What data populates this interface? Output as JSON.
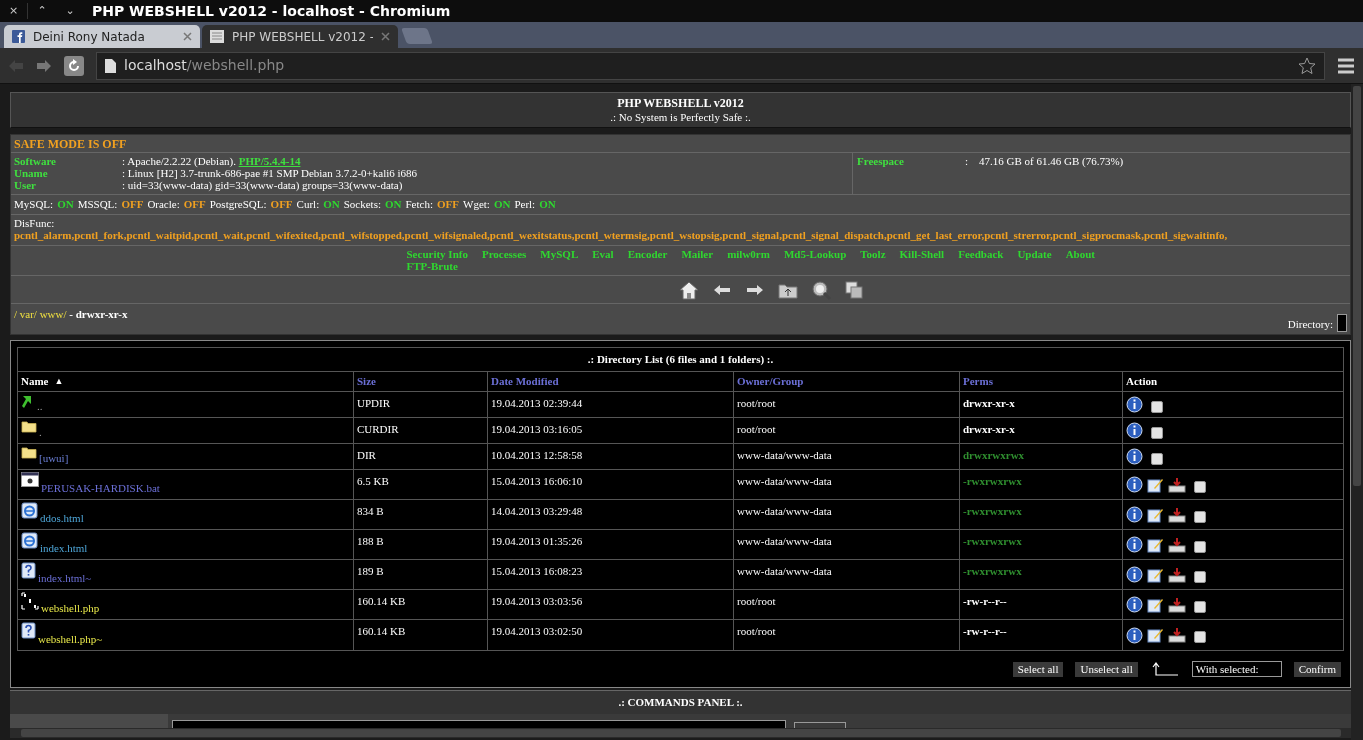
{
  "window": {
    "title": "PHP WEBSHELL v2012 - localhost - Chromium",
    "controls": [
      "×",
      "⌃",
      "⌄"
    ]
  },
  "tabs": [
    {
      "label": "Deini Rony Natada",
      "selected": false,
      "kind": "social"
    },
    {
      "label": "PHP WEBSHELL v2012 -",
      "selected": true,
      "kind": "page"
    }
  ],
  "address": {
    "host": "localhost",
    "path": "/webshell.php"
  },
  "header": {
    "title": "PHP WEBSHELL v2012",
    "subtitle": ".: No System is Perfectly Safe :."
  },
  "safe_mode": "SAFE MODE IS OFF",
  "info": [
    {
      "label": "Software",
      "value": ": Apache/2.2.22 (Debian). ",
      "link": "PHP/5.4.4-14"
    },
    {
      "label": "Uname",
      "value": ": Linux [H2] 3.7-trunk-686-pae #1 SMP Debian 3.7.2-0+kali6 i686"
    },
    {
      "label": "User",
      "value": ": uid=33(www-data) gid=33(www-data) groups=33(www-data)"
    }
  ],
  "freespace": {
    "label": "Freespace",
    "value": ":    47.16 GB of 61.46 GB (76.73%)"
  },
  "services": [
    {
      "name": "MySQL:",
      "status": "ON",
      "on": true
    },
    {
      "name": "MSSQL:",
      "status": "OFF",
      "on": false
    },
    {
      "name": "Oracle:",
      "status": "OFF",
      "on": false
    },
    {
      "name": "PostgreSQL:",
      "status": "OFF",
      "on": false
    },
    {
      "name": "Curl:",
      "status": "ON",
      "on": true
    },
    {
      "name": "Sockets:",
      "status": "ON",
      "on": true
    },
    {
      "name": "Fetch:",
      "status": "OFF",
      "on": false
    },
    {
      "name": "Wget:",
      "status": "ON",
      "on": true
    },
    {
      "name": "Perl:",
      "status": "ON",
      "on": true
    }
  ],
  "disfunc": {
    "label": "DisFunc:",
    "list": "pcntl_alarm,pcntl_fork,pcntl_waitpid,pcntl_wait,pcntl_wifexited,pcntl_wifstopped,pcntl_wifsignaled,pcntl_wexitstatus,pcntl_wtermsig,pcntl_wstopsig,pcntl_signal,pcntl_signal_dispatch,pcntl_get_last_error,pcntl_strerror,pcntl_sigprocmask,pcntl_sigwaitinfo,"
  },
  "menu": [
    "Security Info",
    "Processes",
    "MySQL",
    "Eval",
    "Encoder",
    "Mailer",
    "milw0rm",
    "Md5-Lookup",
    "Toolz",
    "Kill-Shell",
    "Feedback",
    "Update",
    "About",
    "FTP-Brute"
  ],
  "path": {
    "segments": [
      "/ ",
      "var/ ",
      "www/"
    ],
    "perms": " - drwxr-xr-x",
    "directory_label": "Directory:"
  },
  "listing": {
    "title": ".: Directory List (6 files and 1 folders) :.",
    "columns": [
      {
        "label": "Name",
        "sort": "▲",
        "link": false
      },
      {
        "label": "Size",
        "link": true
      },
      {
        "label": "Date Modified",
        "link": true
      },
      {
        "label": "Owner/Group",
        "link": true
      },
      {
        "label": "Perms",
        "link": true
      },
      {
        "label": "Action",
        "link": false
      }
    ],
    "rows": [
      {
        "kind": "updir",
        "name": "..",
        "size": "UPDIR",
        "date": "19.04.2013 02:39:44",
        "owner": "root/root",
        "perms": "drwxr-xr-x",
        "writable": false,
        "checked": false
      },
      {
        "kind": "folder",
        "name": ".",
        "size": "CURDIR",
        "date": "19.04.2013 03:16:05",
        "owner": "root/root",
        "perms": "drwxr-xr-x",
        "writable": false,
        "checked": false
      },
      {
        "kind": "folder",
        "name": "[uwui]",
        "size": "DIR",
        "date": "10.04.2013 12:58:58",
        "owner": "www-data/www-data",
        "perms": "drwxrwxrwx",
        "writable": true,
        "checked": false
      },
      {
        "kind": "bat",
        "name": "PERUSAK-HARDISK.bat",
        "size": "6.5 KB",
        "date": "15.04.2013 16:06:10",
        "owner": "www-data/www-data",
        "perms": "-rwxrwxrwx",
        "writable": true,
        "checked": false
      },
      {
        "kind": "html",
        "name": "ddos.html",
        "size": "834 B",
        "date": "14.04.2013 03:29:48",
        "owner": "www-data/www-data",
        "perms": "-rwxrwxrwx",
        "writable": true,
        "checked": false
      },
      {
        "kind": "html",
        "name": "index.html",
        "size": "188 B",
        "date": "19.04.2013 01:35:26",
        "owner": "www-data/www-data",
        "perms": "-rwxrwxrwx",
        "writable": true,
        "checked": false
      },
      {
        "kind": "unknown",
        "name": "index.html~",
        "size": "189 B",
        "date": "15.04.2013 16:08:23",
        "owner": "www-data/www-data",
        "perms": "-rwxrwxrwx",
        "writable": true,
        "checked": false
      },
      {
        "kind": "php",
        "name": "webshell.php",
        "size": "160.14 KB",
        "date": "19.04.2013 03:03:56",
        "owner": "root/root",
        "perms": "-rw-r--r--",
        "writable": false,
        "checked": false
      },
      {
        "kind": "unknown",
        "name": "webshell.php~",
        "size": "160.14 KB",
        "date": "19.04.2013 03:02:50",
        "owner": "root/root",
        "perms": "-rw-r--r--",
        "writable": false,
        "checked": false
      }
    ]
  },
  "buttons": [
    "Select all",
    "Unselect all"
  ],
  "with_selected": "With selected:",
  "confirm": "Confirm",
  "commands_panel": ".: COMMANDS PANEL :."
}
